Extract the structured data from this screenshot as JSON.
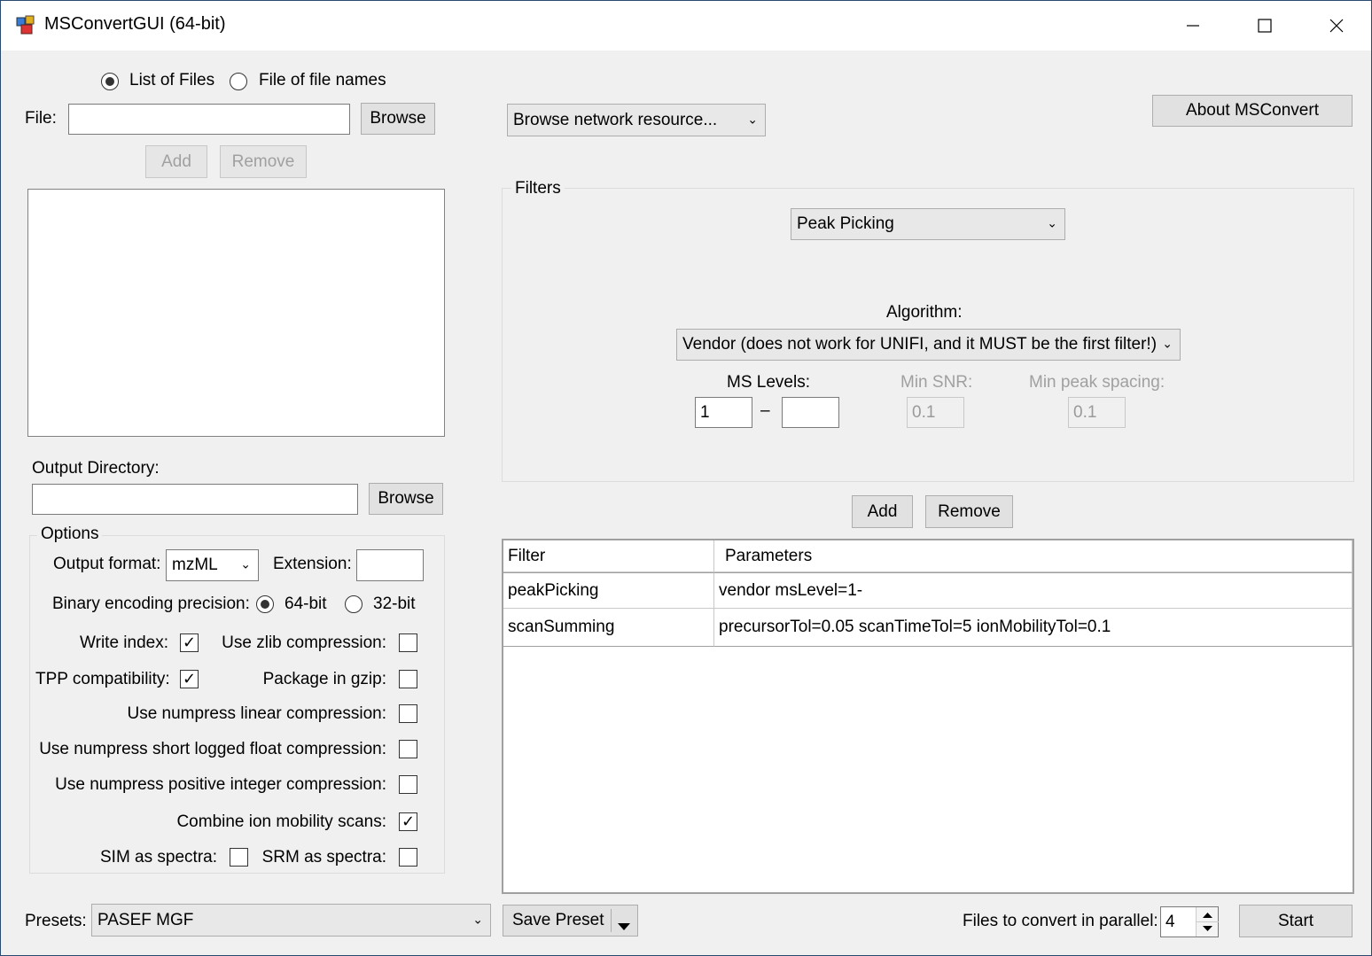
{
  "window": {
    "title": "MSConvertGUI (64-bit)"
  },
  "source": {
    "radio_list": "List of Files",
    "radio_filenames": "File of file names",
    "file_label": "File:",
    "file_value": "",
    "browse": "Browse",
    "add": "Add",
    "remove": "Remove"
  },
  "output": {
    "label": "Output Directory:",
    "value": "",
    "browse": "Browse"
  },
  "options": {
    "title": "Options",
    "format_label": "Output format:",
    "format_value": "mzML",
    "extension_label": "Extension:",
    "extension_value": "",
    "precision_label": "Binary encoding precision:",
    "p64": "64-bit",
    "p32": "32-bit",
    "write_index": "Write index:",
    "zlib": "Use zlib compression:",
    "tpp": "TPP compatibility:",
    "gzip": "Package in gzip:",
    "numpress_linear": "Use numpress linear compression:",
    "numpress_slof": "Use numpress short logged float compression:",
    "numpress_pic": "Use numpress positive integer compression:",
    "combine_ion": "Combine ion mobility scans:",
    "sim": "SIM as spectra:",
    "srm": "SRM as spectra:"
  },
  "network": {
    "value": "Browse network resource..."
  },
  "about": "About MSConvert",
  "filters": {
    "title": "Filters",
    "selected": "Peak Picking",
    "algorithm_label": "Algorithm:",
    "algorithm_value": "Vendor (does not work for UNIFI, and it MUST be the first filter!)",
    "ms_levels_label": "MS Levels:",
    "ms_from": "1",
    "dash": "–",
    "ms_to": "",
    "min_snr_label": "Min SNR:",
    "min_snr": "0.1",
    "min_peak_label": "Min peak spacing:",
    "min_peak": "0.1",
    "add": "Add",
    "remove": "Remove"
  },
  "filter_table": {
    "headers": [
      "Filter",
      "Parameters"
    ],
    "rows": [
      [
        "peakPicking",
        "vendor msLevel=1-"
      ],
      [
        "scanSumming",
        "precursorTol=0.05 scanTimeTol=5 ionMobilityTol=0.1"
      ]
    ]
  },
  "footer": {
    "presets_label": "Presets:",
    "preset_value": "PASEF MGF",
    "save_preset": "Save Preset",
    "parallel_label": "Files to convert in parallel:",
    "parallel_value": "4",
    "start": "Start"
  }
}
